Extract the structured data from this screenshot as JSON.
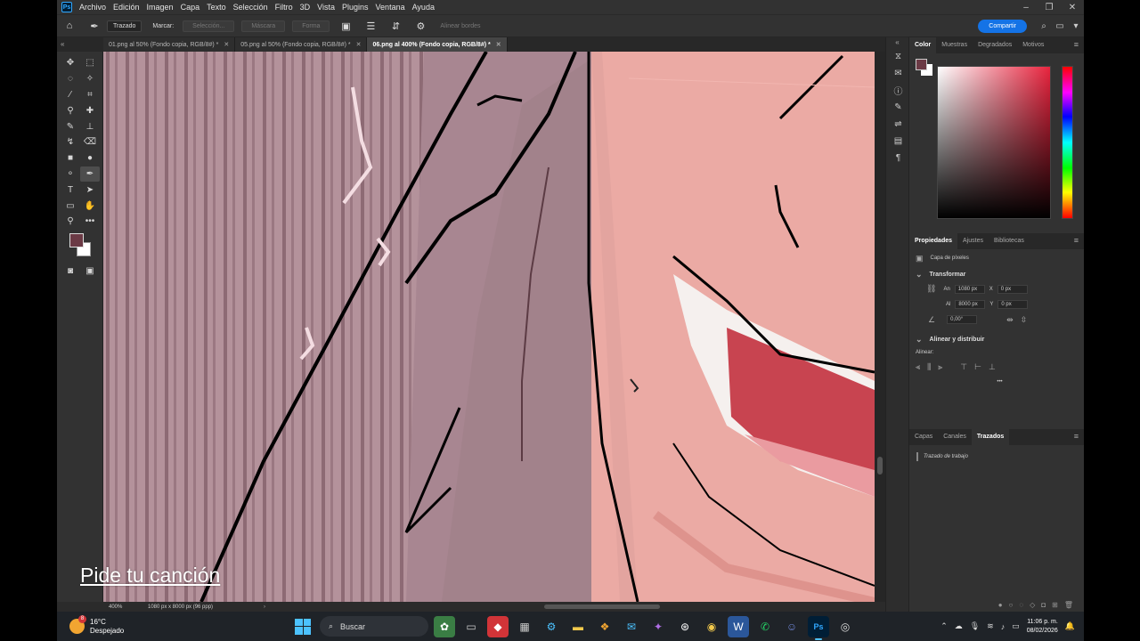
{
  "menu": {
    "items": [
      "Archivo",
      "Edición",
      "Imagen",
      "Capa",
      "Texto",
      "Selección",
      "Filtro",
      "3D",
      "Vista",
      "Plugins",
      "Ventana",
      "Ayuda"
    ],
    "app_badge": "Ps"
  },
  "options": {
    "mode_select": "Trazado",
    "label_marcar": "Marcar:",
    "btn_seleccion": "Selección...",
    "btn_mascara": "Máscara",
    "btn_forma": "Forma",
    "align_edges": "Alinear bordes",
    "share": "Compartir"
  },
  "tabs": [
    {
      "label": "01.png al 50% (Fondo copia, RGB/8#) *",
      "active": false
    },
    {
      "label": "05.png al 50% (Fondo copia, RGB/8#) *",
      "active": false
    },
    {
      "label": "06.png al 400% (Fondo copia, RGB/8#) *",
      "active": true
    }
  ],
  "status": {
    "zoom": "400%",
    "dims": "1080 px x 8000 px (96 ppp)"
  },
  "panels": {
    "color_tabs": [
      "Color",
      "Muestras",
      "Degradados",
      "Motivos"
    ],
    "props_tabs": [
      "Propiedades",
      "Ajustes",
      "Bibliotecas"
    ],
    "layer_type": "Capa de píxeles",
    "transform_title": "Transformar",
    "w_label": "An",
    "w_value": "1080 px",
    "h_label": "Al",
    "h_value": "8000 px",
    "x_label": "X",
    "x_value": "0 px",
    "y_label": "Y",
    "y_value": "0 px",
    "angle_value": "0,00°",
    "align_title": "Alinear y distribuir",
    "align_label": "Alinear:",
    "more": "•••",
    "layers_tabs": [
      "Capas",
      "Canales",
      "Trazados"
    ],
    "path_item": "Trazado de trabajo"
  },
  "caption": "Pide tu canción",
  "taskbar": {
    "weather_temp": "16°C",
    "weather_desc": "Despejado",
    "weather_badge": "8",
    "search": "Buscar",
    "time": "11:06 p. m.",
    "date": "08/02/2026"
  },
  "colors": {
    "foreground": "#6b3a45",
    "background": "#ffffff",
    "accent": "#1473e6"
  }
}
